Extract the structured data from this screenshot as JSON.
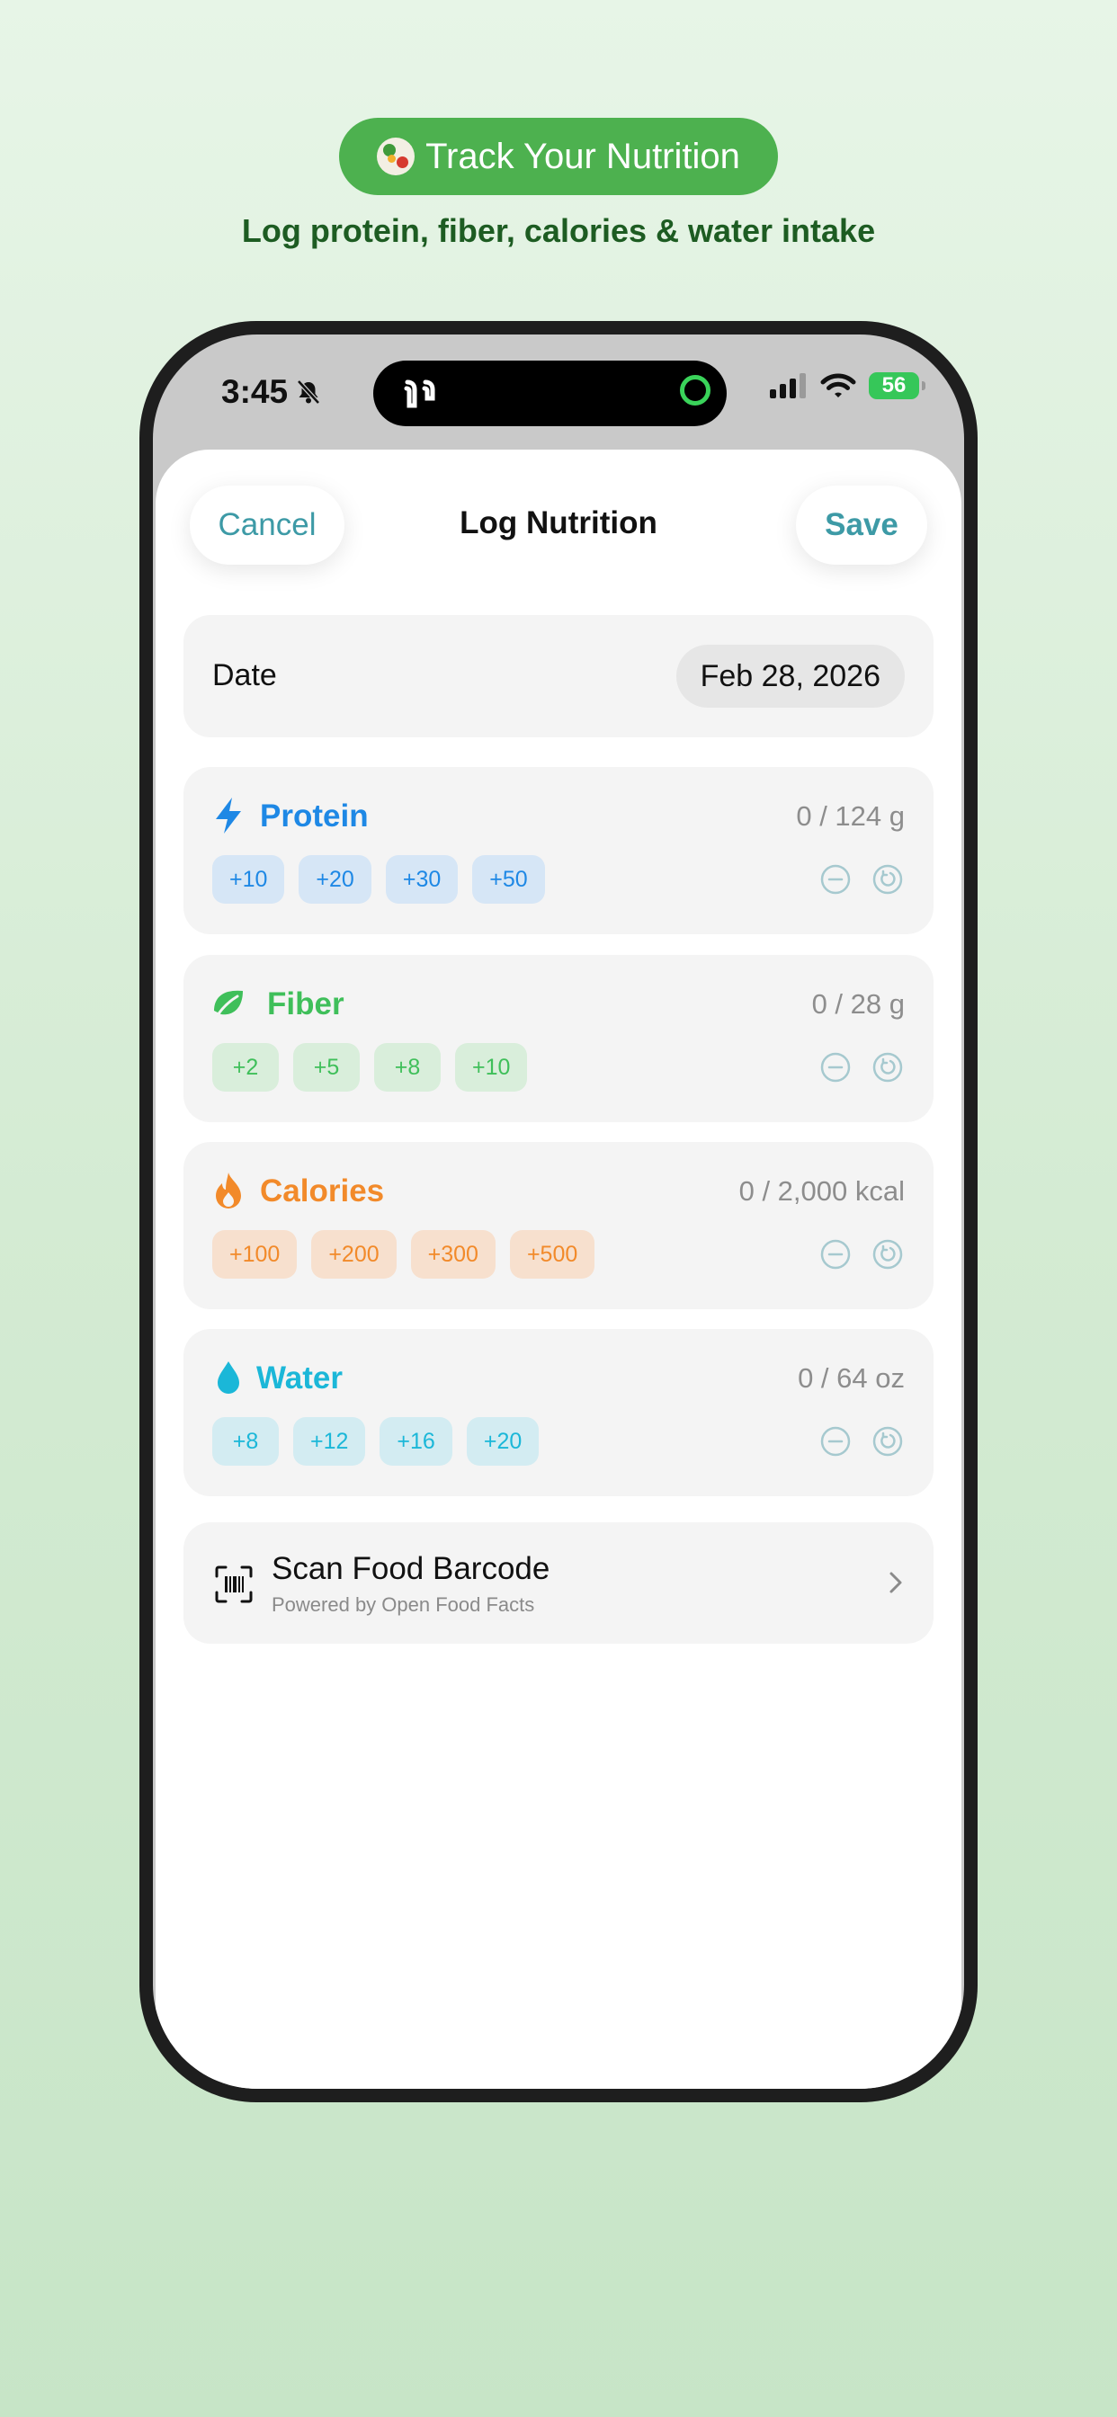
{
  "promo": {
    "pill_text": "Track Your Nutrition",
    "subtitle": "Log protein, fiber, calories & water intake"
  },
  "status_bar": {
    "time": "3:45",
    "battery": "56"
  },
  "nav": {
    "cancel_label": "Cancel",
    "title": "Log Nutrition",
    "save_label": "Save"
  },
  "date": {
    "label": "Date",
    "value": "Feb 28, 2026"
  },
  "metrics": [
    {
      "name": "Protein",
      "total": "0 / 124 g",
      "chips": [
        "+10",
        "+20",
        "+30",
        "+50"
      ],
      "color": "#1e88e5",
      "chip_bg": "#d6e6f6",
      "icon": "bolt-icon"
    },
    {
      "name": "Fiber",
      "total": "0 / 28 g",
      "chips": [
        "+2",
        "+5",
        "+8",
        "+10"
      ],
      "color": "#3fbf5a",
      "chip_bg": "#d9eedb",
      "icon": "leaf-icon"
    },
    {
      "name": "Calories",
      "total": "0 / 2,000 kcal",
      "chips": [
        "+100",
        "+200",
        "+300",
        "+500"
      ],
      "color": "#f28a2a",
      "chip_bg": "#f7e0ce",
      "icon": "flame-icon"
    },
    {
      "name": "Water",
      "total": "0 / 64 oz",
      "chips": [
        "+8",
        "+12",
        "+16",
        "+20"
      ],
      "color": "#1bb7d8",
      "chip_bg": "#d3ecf2",
      "icon": "drop-icon"
    }
  ],
  "scan": {
    "title": "Scan Food Barcode",
    "subtitle": "Powered by Open Food Facts"
  },
  "colors": {
    "accent": "#3d9aa6",
    "control": "#a6c9cf",
    "promo_green": "#4db14f"
  }
}
